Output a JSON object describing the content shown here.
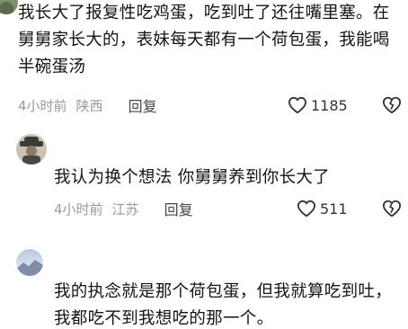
{
  "comments": [
    {
      "text": "我长大了报复性吃鸡蛋，吃到吐了还往嘴里塞。在舅舅家长大的，表妹每天都有一个荷包蛋，我能喝半碗蛋汤",
      "time": "4小时前",
      "location": "陕西",
      "reply_label": "回复",
      "likes": "1185"
    },
    {
      "text": "我认为换个想法 你舅舅养到你长大了",
      "time": "4小时前",
      "location": "江苏",
      "reply_label": "回复",
      "likes": "511"
    },
    {
      "text": "我的执念就是那个荷包蛋，但我就算吃到吐，我都吃不到我想吃的那一个。"
    }
  ],
  "colors": {
    "text": "#141414",
    "meta": "#9a9a9a",
    "icon": "#333333"
  }
}
